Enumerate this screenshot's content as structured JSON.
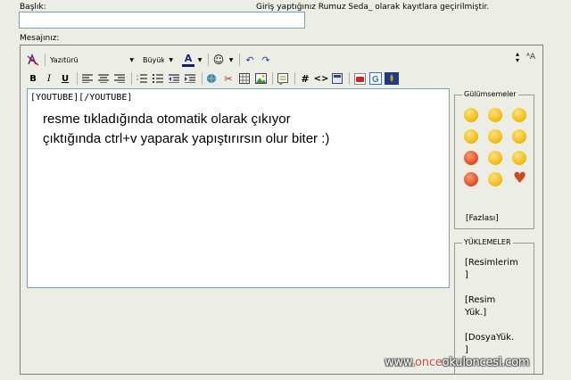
{
  "form": {
    "title_label": "Başlık:",
    "title_value": "",
    "login_info": "Giriş yaptığınız Rumuz Seda_ olarak kayıtlara geçirilmiştir.",
    "message_label": "Mesajınız:"
  },
  "toolbar": {
    "font_select": "Yazıtürü",
    "size_select": "Büyük",
    "color_label": "A"
  },
  "editor": {
    "bbcode_line": "[YOUTUBE][/YOUTUBE]",
    "text_line_1": "resme tıkladığında otomatik olarak çıkıyor",
    "text_line_2": "çıktığında ctrl+v yaparak yapıştırırsın olur biter :)"
  },
  "smileys": {
    "legend": "Gülümsemeler",
    "more_label": "[Fazlası]",
    "icons": [
      "smiley-icon",
      "smiley-icon",
      "smiley-icon",
      "smiley-icon",
      "smiley-icon",
      "smiley-icon",
      "smiley-icon",
      "smiley-icon",
      "smiley-icon",
      "smiley-icon",
      "smiley-icon",
      "heart-icon"
    ]
  },
  "uploads": {
    "legend": "YÜKLEMELER",
    "images": "[Resimlerim\n]",
    "upload_image": "[Resim\nYük.]",
    "upload_file": "[DosyaYük.\n]"
  },
  "watermark": {
    "prefix": "www.",
    "highlight": "once",
    "suffix": "okuloncesi.com"
  },
  "colors": {
    "background": "#eceee6",
    "input_border": "#7f9db9",
    "watermark_highlight": "#e53935"
  }
}
